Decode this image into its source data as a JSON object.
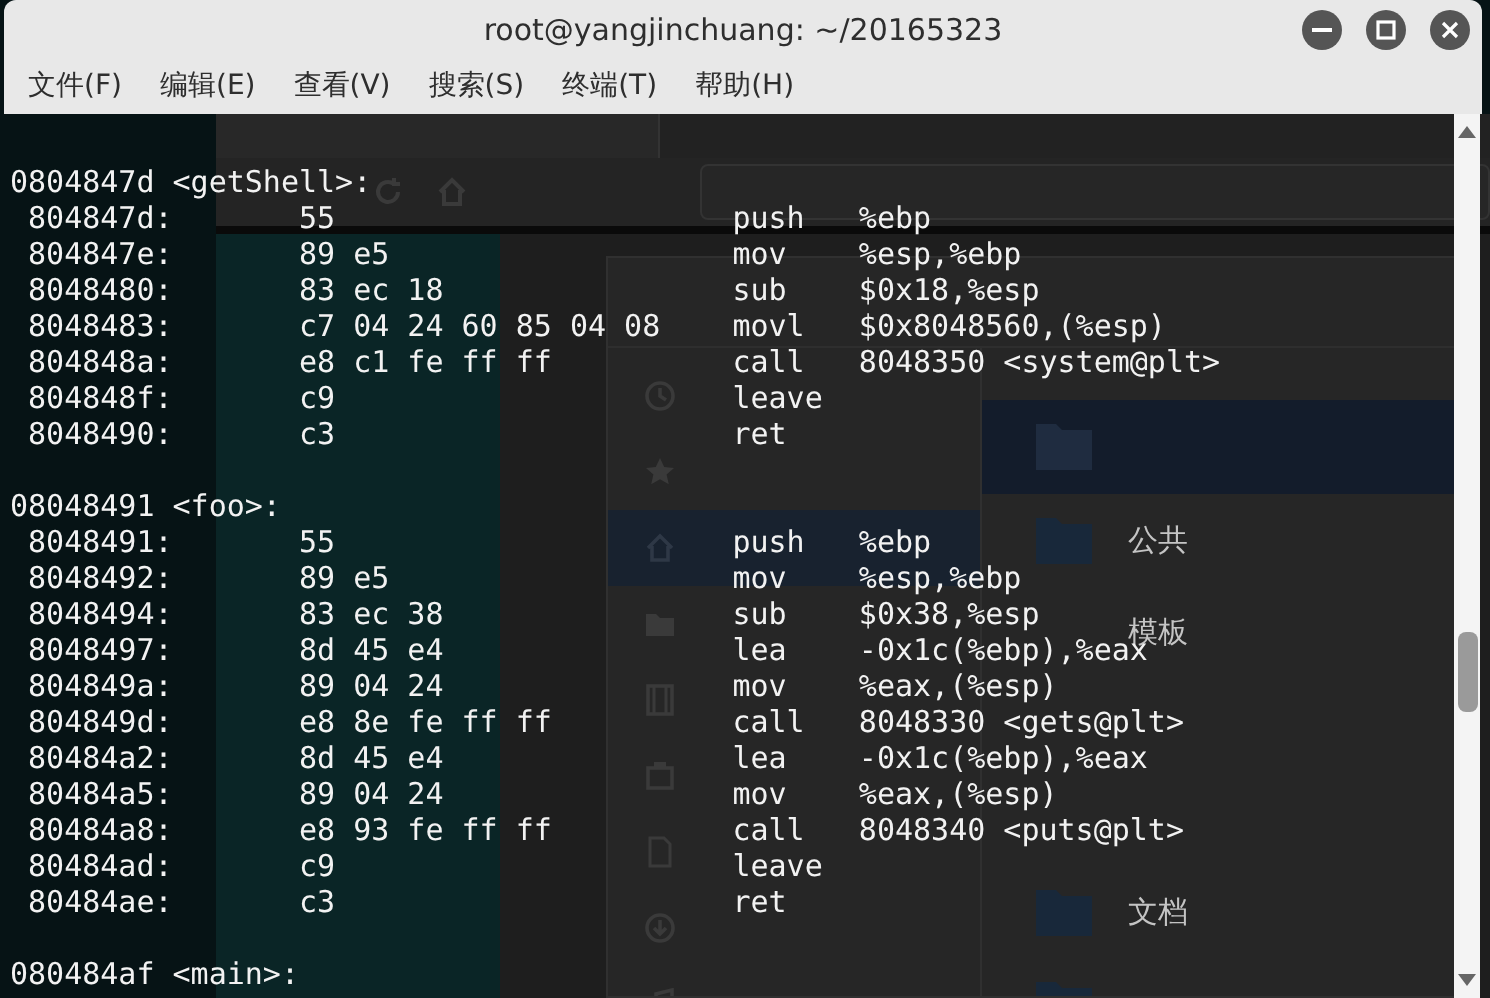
{
  "window": {
    "title": "root@yangjinchuang: ~/20165323"
  },
  "menu": [
    "文件(F)",
    "编辑(E)",
    "查看(V)",
    "搜索(S)",
    "终端(T)",
    "帮助(H)"
  ],
  "background": {
    "folder_names": [
      "公共",
      "模板",
      "文档"
    ]
  },
  "terminal": {
    "lines": [
      {
        "kind": "blank"
      },
      {
        "kind": "label",
        "text": "0804847d <getShell>:"
      },
      {
        "kind": "insn",
        "address": " 804847d:",
        "bytes": "55",
        "mnemonic": "push",
        "operands": "%ebp"
      },
      {
        "kind": "insn",
        "address": " 804847e:",
        "bytes": "89 e5",
        "mnemonic": "mov",
        "operands": "%esp,%ebp"
      },
      {
        "kind": "insn",
        "address": " 8048480:",
        "bytes": "83 ec 18",
        "mnemonic": "sub",
        "operands": "$0x18,%esp"
      },
      {
        "kind": "insn",
        "address": " 8048483:",
        "bytes": "c7 04 24 60 85 04 08",
        "mnemonic": "movl",
        "operands": "$0x8048560,(%esp)"
      },
      {
        "kind": "insn",
        "address": " 804848a:",
        "bytes": "e8 c1 fe ff ff",
        "mnemonic": "call",
        "operands": "8048350 <system@plt>"
      },
      {
        "kind": "insn",
        "address": " 804848f:",
        "bytes": "c9",
        "mnemonic": "leave"
      },
      {
        "kind": "insn",
        "address": " 8048490:",
        "bytes": "c3",
        "mnemonic": "ret"
      },
      {
        "kind": "blank"
      },
      {
        "kind": "label",
        "text": "08048491 <foo>:"
      },
      {
        "kind": "insn",
        "address": " 8048491:",
        "bytes": "55",
        "mnemonic": "push",
        "operands": "%ebp"
      },
      {
        "kind": "insn",
        "address": " 8048492:",
        "bytes": "89 e5",
        "mnemonic": "mov",
        "operands": "%esp,%ebp"
      },
      {
        "kind": "insn",
        "address": " 8048494:",
        "bytes": "83 ec 38",
        "mnemonic": "sub",
        "operands": "$0x38,%esp"
      },
      {
        "kind": "insn",
        "address": " 8048497:",
        "bytes": "8d 45 e4",
        "mnemonic": "lea",
        "operands": "-0x1c(%ebp),%eax"
      },
      {
        "kind": "insn",
        "address": " 804849a:",
        "bytes": "89 04 24",
        "mnemonic": "mov",
        "operands": "%eax,(%esp)"
      },
      {
        "kind": "insn",
        "address": " 804849d:",
        "bytes": "e8 8e fe ff ff",
        "mnemonic": "call",
        "operands": "8048330 <gets@plt>"
      },
      {
        "kind": "insn",
        "address": " 80484a2:",
        "bytes": "8d 45 e4",
        "mnemonic": "lea",
        "operands": "-0x1c(%ebp),%eax"
      },
      {
        "kind": "insn",
        "address": " 80484a5:",
        "bytes": "89 04 24",
        "mnemonic": "mov",
        "operands": "%eax,(%esp)"
      },
      {
        "kind": "insn",
        "address": " 80484a8:",
        "bytes": "e8 93 fe ff ff",
        "mnemonic": "call",
        "operands": "8048340 <puts@plt>"
      },
      {
        "kind": "insn",
        "address": " 80484ad:",
        "bytes": "c9",
        "mnemonic": "leave"
      },
      {
        "kind": "insn",
        "address": " 80484ae:",
        "bytes": "c3",
        "mnemonic": "ret"
      },
      {
        "kind": "blank"
      },
      {
        "kind": "label",
        "text": "080484af <main>:"
      }
    ]
  }
}
